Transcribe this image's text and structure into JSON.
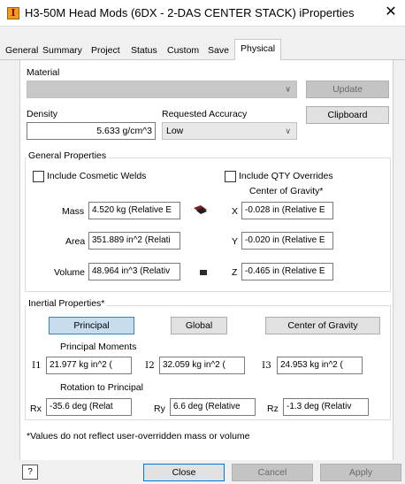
{
  "window": {
    "title": "H3-50M Head Mods (6DX - 2-DAS CENTER STACK) iProperties",
    "close_glyph": "✕",
    "app_icon_glyph": "I"
  },
  "tabs": [
    {
      "label": "General",
      "active": false
    },
    {
      "label": "Summary",
      "active": false
    },
    {
      "label": "Project",
      "active": false
    },
    {
      "label": "Status",
      "active": false
    },
    {
      "label": "Custom",
      "active": false
    },
    {
      "label": "Save",
      "active": false
    },
    {
      "label": "Physical",
      "active": true
    }
  ],
  "material": {
    "label": "Material",
    "value": "",
    "update_label": "Update",
    "clipboard_label": "Clipboard"
  },
  "density": {
    "label": "Density",
    "value": "5.633 g/cm^3"
  },
  "accuracy": {
    "label": "Requested Accuracy",
    "value": "Low"
  },
  "general_properties": {
    "title": "General Properties",
    "cosmetic_welds_label": "Include Cosmetic Welds",
    "qty_overrides_label": "Include QTY Overrides",
    "cog_title": "Center of Gravity*",
    "mass_label": "Mass",
    "mass_value": "4.520 kg (Relative E",
    "area_label": "Area",
    "area_value": "351.889 in^2 (Relati",
    "volume_label": "Volume",
    "volume_value": "48.964 in^3 (Relativ",
    "x_label": "X",
    "x_value": "-0.028 in (Relative E",
    "y_label": "Y",
    "y_value": "-0.020 in (Relative E",
    "z_label": "Z",
    "z_value": "-0.465 in (Relative E"
  },
  "inertial_properties": {
    "title": "Inertial Properties*",
    "principal_label": "Principal",
    "global_label": "Global",
    "cog_label": "Center of Gravity",
    "moments_title": "Principal Moments",
    "i1_label": "I1",
    "i1_value": "21.977 kg in^2 (",
    "i2_label": "I2",
    "i2_value": "32.059 kg in^2 (",
    "i3_label": "I3",
    "i3_value": "24.953 kg in^2 (",
    "rotation_title": "Rotation to Principal",
    "rx_label": "Rx",
    "rx_value": "-35.6 deg (Relat",
    "ry_label": "Ry",
    "ry_value": "6.6 deg (Relative",
    "rz_label": "Rz",
    "rz_value": "-1.3 deg (Relativ"
  },
  "note": "*Values do not reflect user-overridden mass or volume",
  "footer": {
    "help_glyph": "?",
    "close_label": "Close",
    "cancel_label": "Cancel",
    "apply_label": "Apply"
  }
}
